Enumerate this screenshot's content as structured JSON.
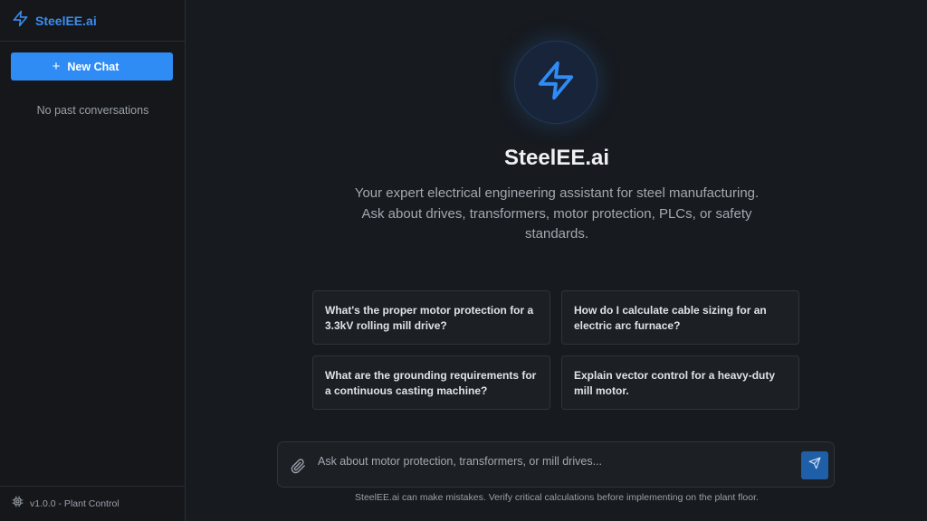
{
  "colors": {
    "accent": "#2f8cf4",
    "brand_text": "#3b8df0",
    "background": "#171a1f",
    "sidebar_bg": "#15171b",
    "card_bg": "#1c1f24"
  },
  "sidebar": {
    "brand_icon": "lightning-bolt-icon",
    "brand_name": "SteelEE.ai",
    "new_chat_icon": "plus-icon",
    "new_chat_label": "New Chat",
    "empty_text": "No past conversations",
    "footer_icon": "chip-icon",
    "version": "v1.0.0 - Plant Control"
  },
  "hero": {
    "icon": "lightning-bolt-icon",
    "title": "SteelEE.ai",
    "subtitle": "Your expert electrical engineering assistant for steel manufacturing. Ask about drives, transformers, motor protection, PLCs, or safety standards."
  },
  "suggestions": [
    {
      "text": "What's the proper motor protection for a 3.3kV rolling mill drive?"
    },
    {
      "text": "How do I calculate cable sizing for an electric arc furnace?"
    },
    {
      "text": "What are the grounding requirements for a continuous casting machine?"
    },
    {
      "text": "Explain vector control for a heavy-duty mill motor."
    }
  ],
  "composer": {
    "attach_icon": "paperclip-icon",
    "placeholder": "Ask about motor protection, transformers, or mill drives...",
    "value": "",
    "send_icon": "send-icon"
  },
  "disclaimer": "SteelEE.ai can make mistakes. Verify critical calculations before implementing on the plant floor."
}
